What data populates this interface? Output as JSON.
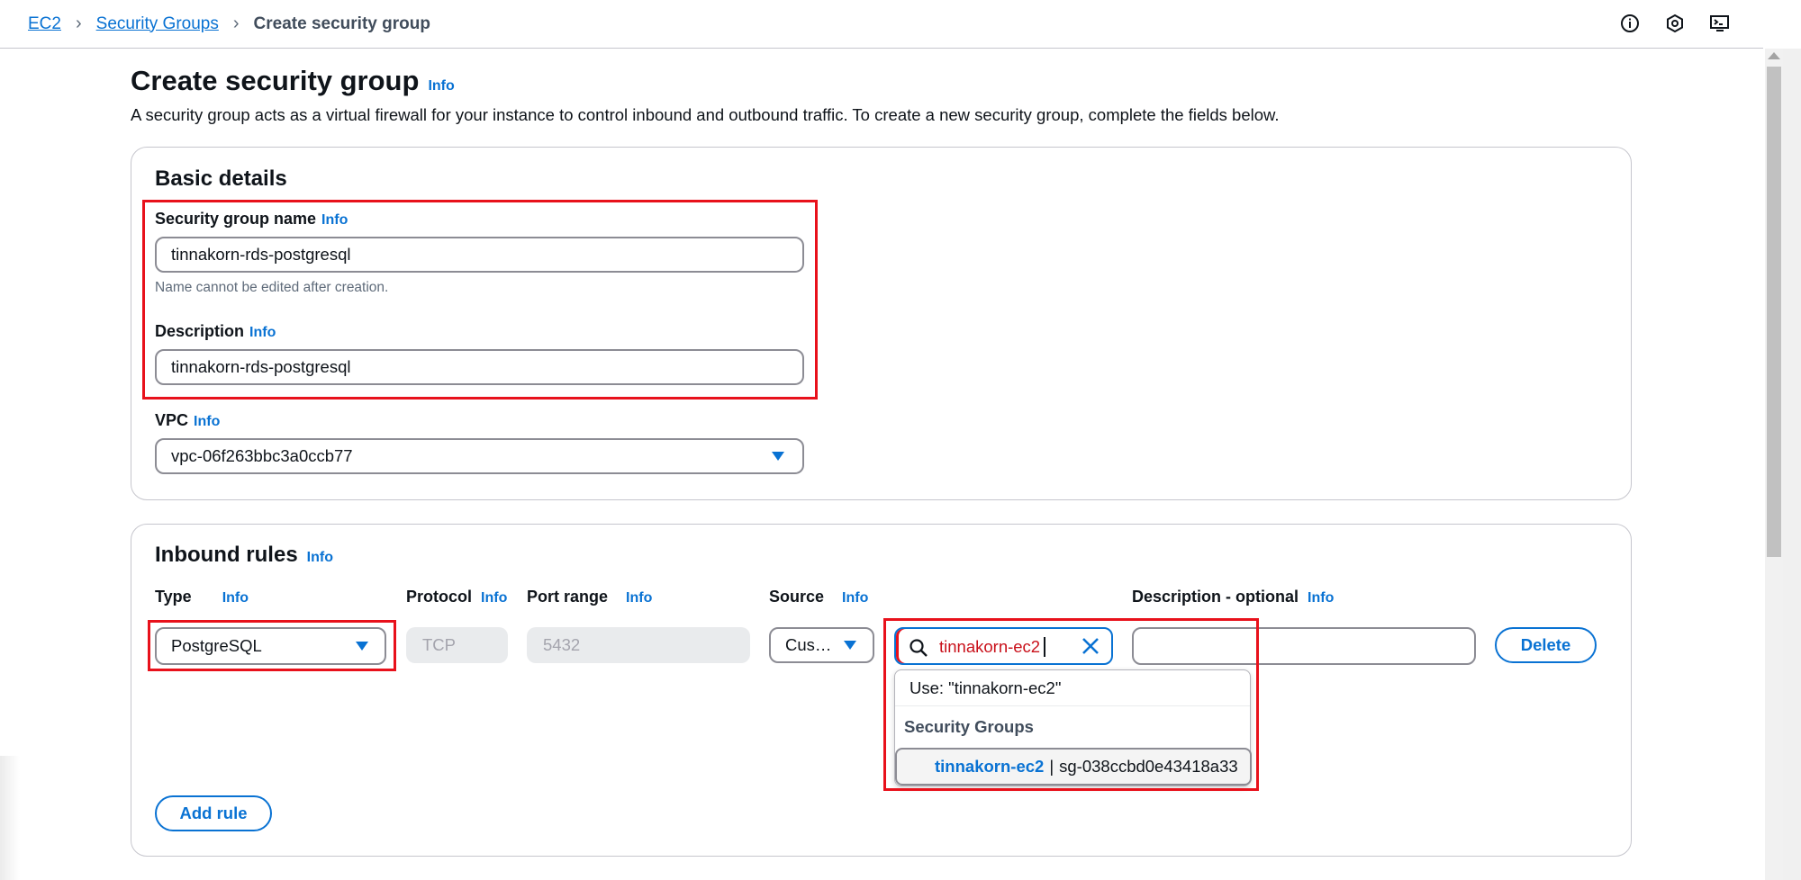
{
  "breadcrumb": {
    "items": [
      {
        "label": "EC2"
      },
      {
        "label": "Security Groups"
      }
    ],
    "current": "Create security group"
  },
  "top_icons": [
    "info-circle-icon",
    "settings-hex-icon",
    "cloudshell-icon"
  ],
  "page": {
    "title": "Create security group",
    "info": "Info",
    "description": "A security group acts as a virtual firewall for your instance to control inbound and outbound traffic. To create a new security group, complete the fields below."
  },
  "basic_details": {
    "title": "Basic details",
    "name": {
      "label": "Security group name",
      "info": "Info",
      "value": "tinnakorn-rds-postgresql",
      "hint": "Name cannot be edited after creation."
    },
    "description": {
      "label": "Description",
      "info": "Info",
      "value": "tinnakorn-rds-postgresql"
    },
    "vpc": {
      "label": "VPC",
      "info": "Info",
      "value": "vpc-06f263bbc3a0ccb77"
    }
  },
  "inbound_rules": {
    "title": "Inbound rules",
    "info": "Info",
    "columns": {
      "type": "Type",
      "protocol": "Protocol",
      "port_range": "Port range",
      "source": "Source",
      "description": "Description - optional",
      "info": "Info"
    },
    "row": {
      "type": "PostgreSQL",
      "protocol": "TCP",
      "port_range": "5432",
      "source": "Cus…",
      "search_value": "tinnakorn-ec2",
      "description": "",
      "delete_label": "Delete"
    },
    "dropdown": {
      "use_option": "Use: \"tinnakorn-ec2\"",
      "group_label": "Security Groups",
      "option_name": "tinnakorn-ec2",
      "option_separator": "|",
      "option_id": "sg-038ccbd0e43418a33"
    },
    "add_rule_label": "Add rule"
  },
  "colors": {
    "link": "#0972d3",
    "highlight": "#e8111b",
    "border": "#8c8c94"
  }
}
